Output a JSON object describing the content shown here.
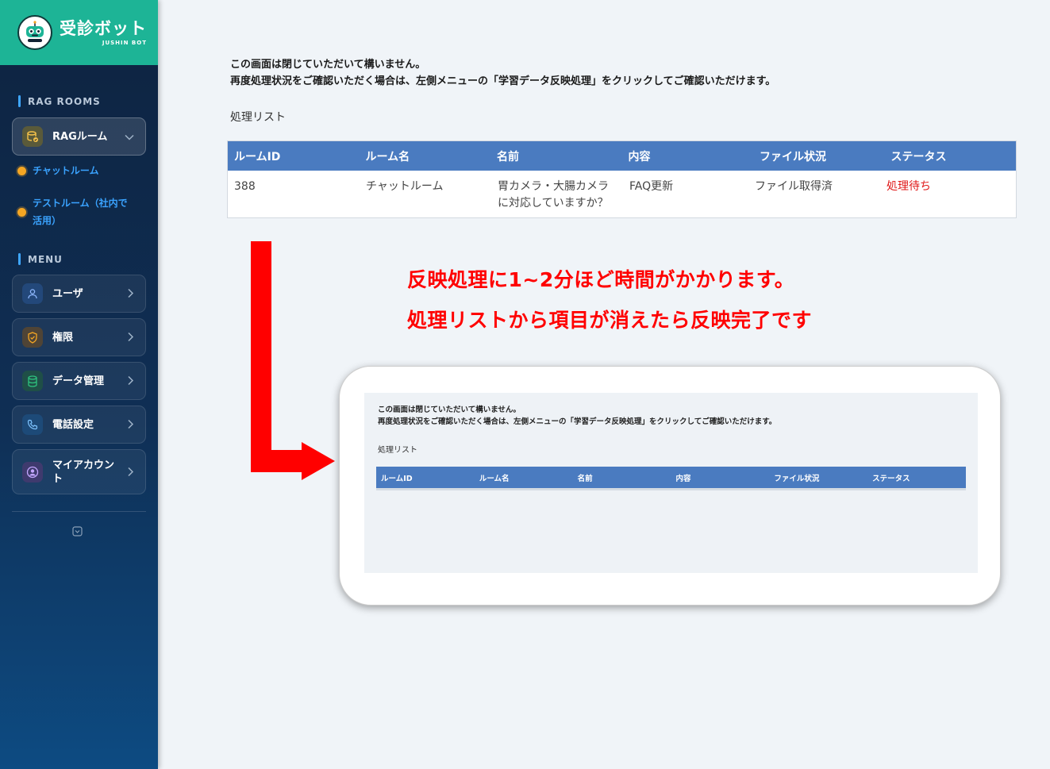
{
  "brand": {
    "title": "受診ボット",
    "subtitle": "JUSHIN BOT",
    "logo_text": "JUSHIN BOT"
  },
  "sidebar": {
    "rag_section": "RAG ROOMS",
    "rag_room": {
      "label": "RAGルーム",
      "icon": "database-check-icon"
    },
    "rooms": [
      {
        "label": "チャットルーム"
      },
      {
        "label": "テストルーム（社内で活用）"
      }
    ],
    "menu_section": "MENU",
    "menu": [
      {
        "label": "ユーザ",
        "icon": "user-icon",
        "color": "#3f7fd9"
      },
      {
        "label": "権限",
        "icon": "shield-check-icon",
        "color": "#f5a623"
      },
      {
        "label": "データ管理",
        "icon": "database-icon",
        "color": "#2ec27e"
      },
      {
        "label": "電話設定",
        "icon": "phone-icon",
        "color": "#3f9fe0"
      },
      {
        "label": "マイアカウント",
        "icon": "account-circle-icon",
        "color": "#b388ff"
      }
    ]
  },
  "main": {
    "notice_line1": "この画面は閉じていただいて構いません。",
    "notice_line2": "再度処理状況をご確認いただく場合は、左側メニューの「学習データ反映処理」をクリックしてご確認いただけます。",
    "list_title": "処理リスト",
    "table": {
      "headers": [
        "ルームID",
        "ルーム名",
        "名前",
        "内容",
        "ファイル状況",
        "ステータス"
      ],
      "rows": [
        {
          "room_id": "388",
          "room_name": "チャットルーム",
          "name": "胃カメラ・大腸カメラに対応していますか？",
          "content": "FAQ更新",
          "file_status": "ファイル取得済",
          "status": "処理待ち"
        }
      ],
      "header_color": "#4a7bc0",
      "status_color": "#e01a1a"
    }
  },
  "annotation": {
    "line1": "反映処理に1~2分ほど時間がかかります。",
    "line2": "処理リストから項目が消えたら反映完了です",
    "color": "#ff0000"
  },
  "preview": {
    "notice_line1": "この画面は閉じていただいて構いません。",
    "notice_line2": "再度処理状況をご確認いただく場合は、左側メニューの「学習データ反映処理」をクリックしてご確認いただけます。",
    "list_title": "処理リスト",
    "headers": [
      "ルームID",
      "ルーム名",
      "名前",
      "内容",
      "ファイル状況",
      "ステータス"
    ]
  }
}
